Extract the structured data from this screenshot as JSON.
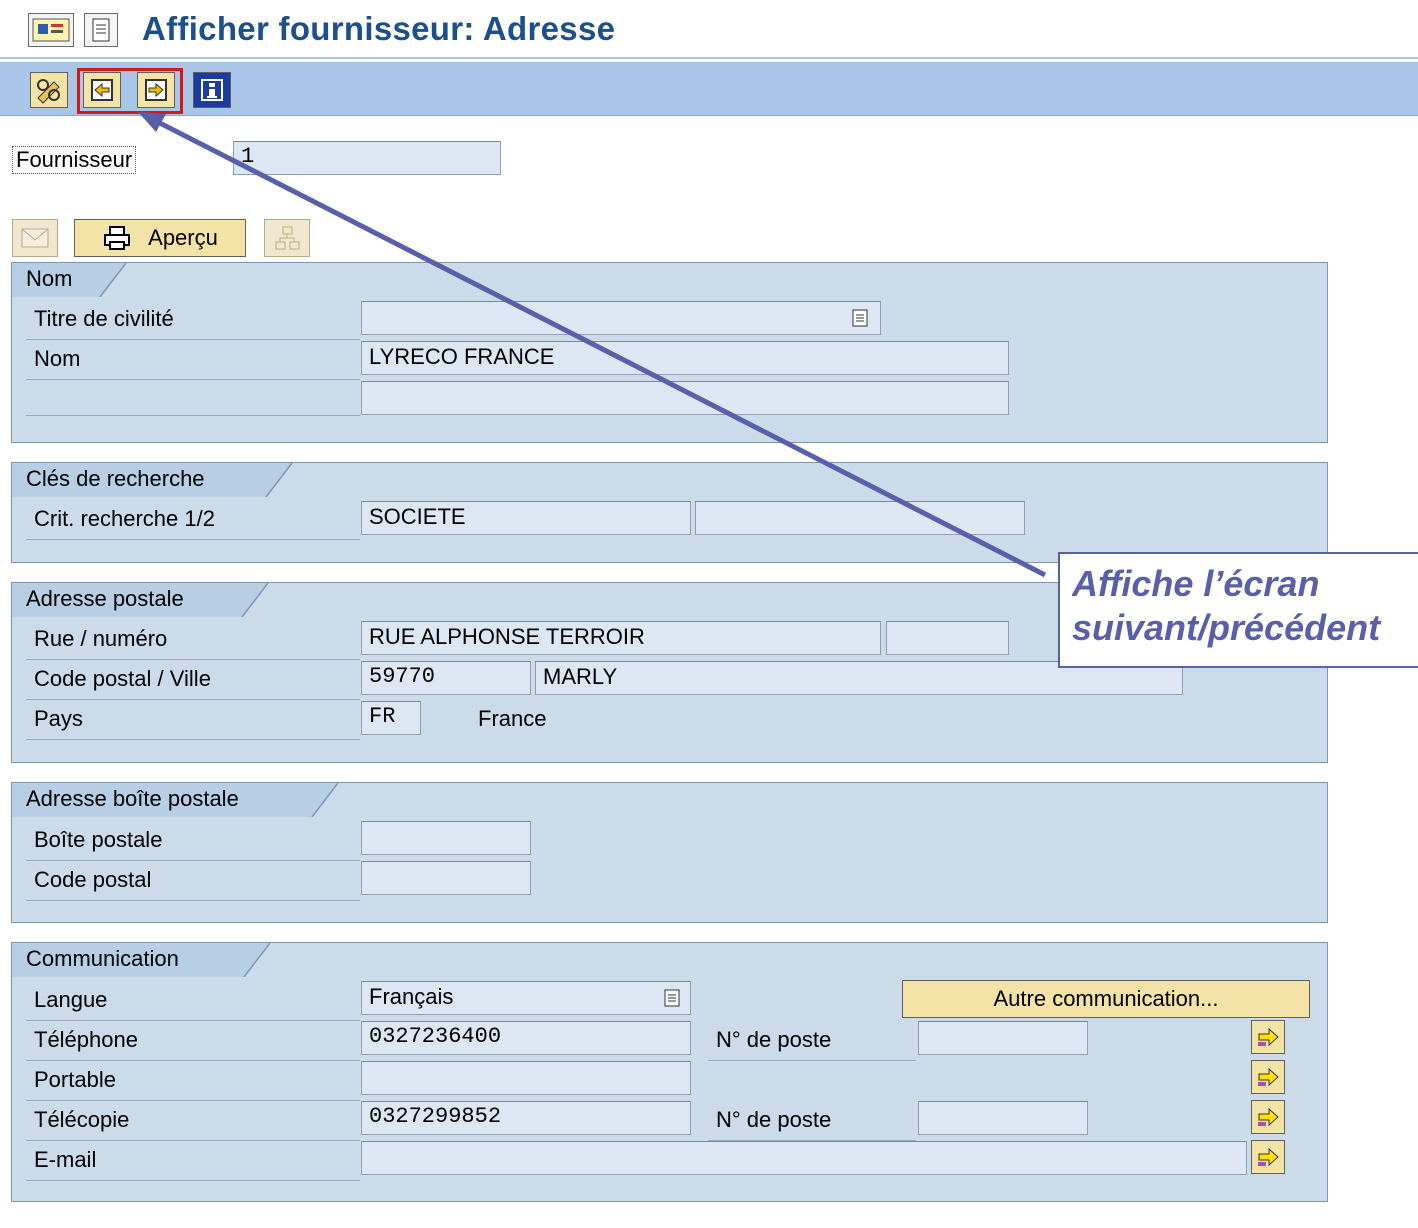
{
  "window": {
    "title": "Afficher fournisseur: Adresse"
  },
  "header": {
    "fournisseur_label": "Fournisseur",
    "fournisseur_value": "1"
  },
  "actions": {
    "apercu_label": "Aperçu"
  },
  "groups": {
    "nom": {
      "title": "Nom",
      "titre_label": "Titre de civilité",
      "titre_value": "",
      "nom_label": "Nom",
      "nom_value": "LYRECO FRANCE",
      "nom2_value": ""
    },
    "cles": {
      "title": "Clés de recherche",
      "crit_label": "Crit. recherche 1/2",
      "crit1_value": "SOCIETE",
      "crit2_value": ""
    },
    "postale": {
      "title": "Adresse postale",
      "rue_label": "Rue / numéro",
      "rue_value": "RUE ALPHONSE TERROIR",
      "numero_value": "",
      "cp_label": "Code postal / Ville",
      "cp_value": "59770",
      "ville_value": "MARLY",
      "pays_label": "Pays",
      "pays_value": "FR",
      "pays_name": "France"
    },
    "bp": {
      "title": "Adresse boîte postale",
      "bp_label": "Boîte postale",
      "bp_value": "",
      "cp_label": "Code postal",
      "cp_value": ""
    },
    "comm": {
      "title": "Communication",
      "langue_label": "Langue",
      "langue_value": "Français",
      "autre_label": "Autre communication...",
      "tel_label": "Téléphone",
      "tel_value": "0327236400",
      "poste_label": "N° de poste",
      "tel_poste_value": "",
      "portable_label": "Portable",
      "portable_value": "",
      "fax_label": "Télécopie",
      "fax_value": "0327299852",
      "fax_poste_value": "",
      "email_label": "E-mail",
      "email_value": ""
    }
  },
  "callout": {
    "line1": "Affiche l’écran",
    "line2": "suivant/précédent"
  },
  "icons": [
    "display-change-icon",
    "document-icon",
    "pencil-glasses-icon",
    "previous-screen-icon",
    "next-screen-icon",
    "info-icon",
    "envelope-icon",
    "printer-icon",
    "org-chart-icon",
    "dropdown-icon",
    "arrow-right-icon"
  ],
  "colors": {
    "title": "#1c4f8c",
    "toolbar": "#a9c5e8",
    "group_bg": "#cbdbea",
    "field_bg": "#dde7f3",
    "button": "#f3e3a6",
    "highlight": "#d21a1a",
    "callout": "#5a5fa9"
  }
}
